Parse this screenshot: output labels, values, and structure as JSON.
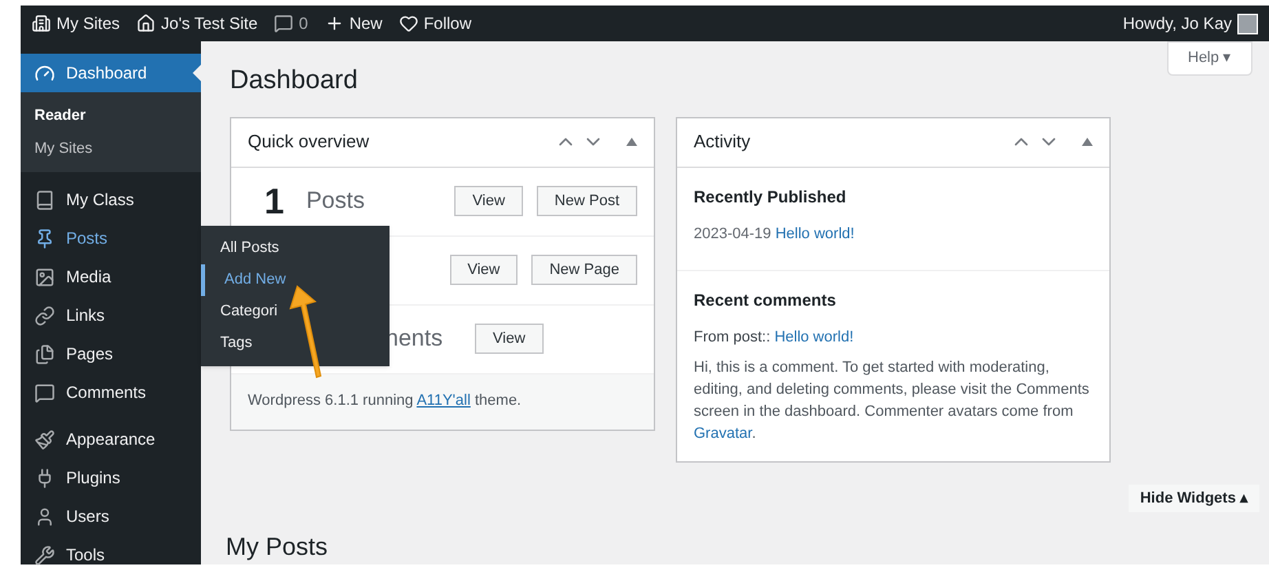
{
  "top_bar": {
    "items": [
      {
        "kind": "sites",
        "label": "My Sites"
      },
      {
        "kind": "home",
        "label": "Jo's Test Site"
      },
      {
        "kind": "comments",
        "label": "0"
      },
      {
        "kind": "new",
        "label": "New"
      },
      {
        "kind": "follow",
        "label": "Follow"
      }
    ],
    "greeting": "Howdy, Jo Kay"
  },
  "sidebar": {
    "items": [
      {
        "kind": "dashboard",
        "label": "Dashboard",
        "selected": true,
        "hovered": false,
        "submenu": [
          {
            "label": "Reader",
            "selected": true
          },
          {
            "label": "My Sites",
            "selected": false
          }
        ]
      },
      {
        "kind": "class",
        "label": "My Class",
        "selected": false,
        "hovered": false
      },
      {
        "kind": "posts",
        "label": "Posts",
        "selected": false,
        "hovered": true
      },
      {
        "kind": "media",
        "label": "Media",
        "selected": false,
        "hovered": false
      },
      {
        "kind": "links",
        "label": "Links",
        "selected": false,
        "hovered": false
      },
      {
        "kind": "pages",
        "label": "Pages",
        "selected": false,
        "hovered": false
      },
      {
        "kind": "comments",
        "label": "Comments",
        "selected": false,
        "hovered": false
      },
      {
        "kind": "appearance",
        "label": "Appearance",
        "selected": false,
        "hovered": false
      },
      {
        "kind": "plugins",
        "label": "Plugins",
        "selected": false,
        "hovered": false
      },
      {
        "kind": "users",
        "label": "Users",
        "selected": false,
        "hovered": false
      },
      {
        "kind": "tools",
        "label": "Tools",
        "selected": false,
        "hovered": false
      }
    ]
  },
  "flyout": {
    "items": [
      {
        "label": "All Posts",
        "selected": false
      },
      {
        "label": "Add New",
        "selected": true
      },
      {
        "label": "Categori",
        "selected": false
      },
      {
        "label": "Tags",
        "selected": false
      }
    ]
  },
  "help_button": "Help ▾",
  "page_title": "Dashboard",
  "quick_overview": {
    "title": "Quick overview",
    "rows": [
      {
        "count": "1",
        "label": "Posts",
        "buttons": [
          "View",
          "New Post"
        ]
      },
      {
        "buttons": [
          "View",
          "New Page"
        ]
      },
      {
        "label": "nents",
        "buttons": [
          "View"
        ]
      }
    ],
    "footer": {
      "before": "Wordpress 6.1.1 running",
      "link": "A11Y'all",
      "after": "theme."
    }
  },
  "activity": {
    "title": "Activity",
    "recently_published": {
      "heading": "Recently Published",
      "date": "2023-04-19",
      "link": "Hello world!"
    },
    "recent_comments": {
      "heading": "Recent comments",
      "from": "From post::",
      "link": "Hello world!",
      "text": "Hi, this is a comment. To get started with moderating, editing, and deleting comments, please visit the Comments screen in the dashboard. Commenter avatars come from",
      "text_link": "Gravatar",
      "text_end": "."
    }
  },
  "hide_widgets": "Hide Widgets ▴",
  "section_title": "My Posts"
}
